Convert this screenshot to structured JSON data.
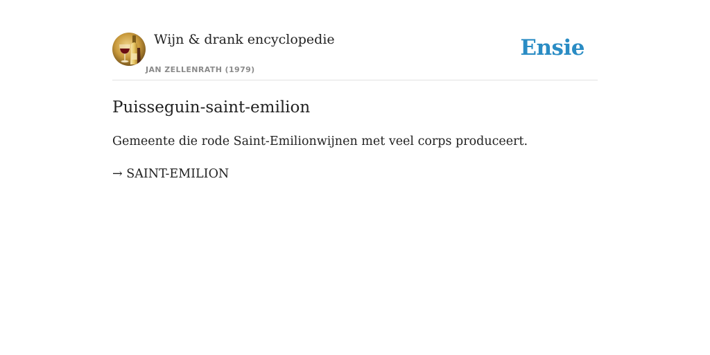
{
  "header": {
    "encyclopedia_title": "Wijn & drank encyclopedie",
    "author": "JAN ZELLENRATH (1979)",
    "brand": "Ensie",
    "logo_icon": "wine-bottle-glass-icon"
  },
  "entry": {
    "title": "Puisseguin-saint-emilion",
    "definition": "Gemeente die rode Saint-Emilionwijnen met veel corps produceert.",
    "see_also_arrow": "→",
    "see_also_link": "SAINT-EMILION"
  },
  "colors": {
    "brand": "#2a8cc4",
    "text": "#222222",
    "muted": "#8a8a8a",
    "divider": "#e2e2e2"
  }
}
